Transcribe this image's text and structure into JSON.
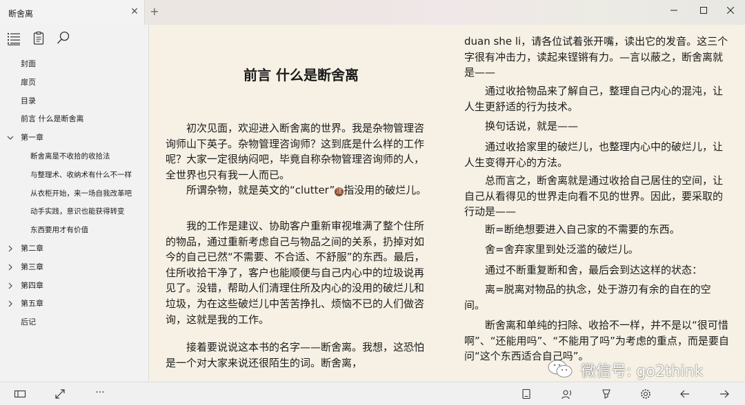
{
  "window": {
    "tab_title": "断舍离",
    "close_tab_glyph": "✕",
    "new_tab_glyph": "+",
    "minimize_glyph": "—",
    "maximize_glyph": "☐",
    "close_glyph": "✕"
  },
  "toc": {
    "items": [
      {
        "label": "封面",
        "level": 0
      },
      {
        "label": "扉页",
        "level": 0
      },
      {
        "label": "目录",
        "level": 0
      },
      {
        "label": "前言 什么是断舍离",
        "level": 0
      },
      {
        "label": "第一章",
        "level": 0,
        "expanded": true
      },
      {
        "label": "断舍离是不收拾的收拾法",
        "level": 1
      },
      {
        "label": "与整理术、收纳术有什么不一样",
        "level": 1
      },
      {
        "label": "从衣柜开始，来一场自我改革吧",
        "level": 1
      },
      {
        "label": "动手实践，意识也能获得转变",
        "level": 1
      },
      {
        "label": "东西要用才有价值",
        "level": 1
      },
      {
        "label": "第二章",
        "level": 0,
        "expanded": false
      },
      {
        "label": "第三章",
        "level": 0,
        "expanded": false
      },
      {
        "label": "第四章",
        "level": 0,
        "expanded": false
      },
      {
        "label": "第五章",
        "level": 0,
        "expanded": false
      },
      {
        "label": "后记",
        "level": 0
      }
    ]
  },
  "book": {
    "chapter_title": "前言 什么是断舍离",
    "left_paragraphs": [
      "初次见面，欢迎进入断舍离的世界。我是杂物管理咨询师山下英子。杂物管理咨询师？这到底是什么样的工作呢？大家一定很纳闷吧，毕竟自称杂物管理咨询师的人，全世界也只有我一人而已。",
      "我的工作是建议、协助客户重新审视堆满了整个住所的物品，通过重新考虑自己与物品之间的关系，扔掉对如今的自己已然“不需要、不合适、不舒服”的东西。最后，住所收拾干净了，客户也能顺便与自己内心中的垃圾说再见了。没错，帮助人们清理住所及内心的没用的破烂儿和垃圾，为在这些破烂儿中苦苦挣扎、烦恼不已的人们做咨询，这就是我的工作。",
      "接着要说说这本书的名字——断舍离。我想，这恐怕是一个对大家来说还很陌生的词。断舍离，"
    ],
    "clutter_before": "所谓杂物，就是英文的“clutter”",
    "clutter_note": "注",
    "clutter_after": "指没用的破烂儿。",
    "right_continuation": "duan she li，请各位试着张开嘴，读出它的发音。这三个字很有冲击力，读起来铿锵有力。—言以蔽之，断舍离就是——",
    "right_paragraphs": [
      "通过收拾物品来了解自己，整理自己内心的混沌，让人生更舒适的行为技术。",
      "换句话说，就是——",
      "通过收拾家里的破烂儿，也整理内心中的破烂儿，让人生变得开心的方法。",
      "总而言之，断舍离就是通过收拾自己居住的空间，让自己从看得见的世界走向看不见的世界。因此，要采取的行动是——",
      "断=断绝想要进入自己家的不需要的东西。",
      "舍=舍弃家里到处泛滥的破烂儿。",
      "通过不断重复断和舍，最后会到达这样的状态：",
      "离=脱离对物品的执念，处于游刃有余的自在的空间。",
      "断舍离和单纯的扫除、收拾不一样，并不是以“很可惜啊”、“还能用吗”、“不能用了吗”为考虑的重点，而是要自问“这个东西适合自己吗”。"
    ]
  },
  "watermark": {
    "text": "微信号: go2think"
  },
  "bottombar": {
    "more_glyph": "···"
  }
}
